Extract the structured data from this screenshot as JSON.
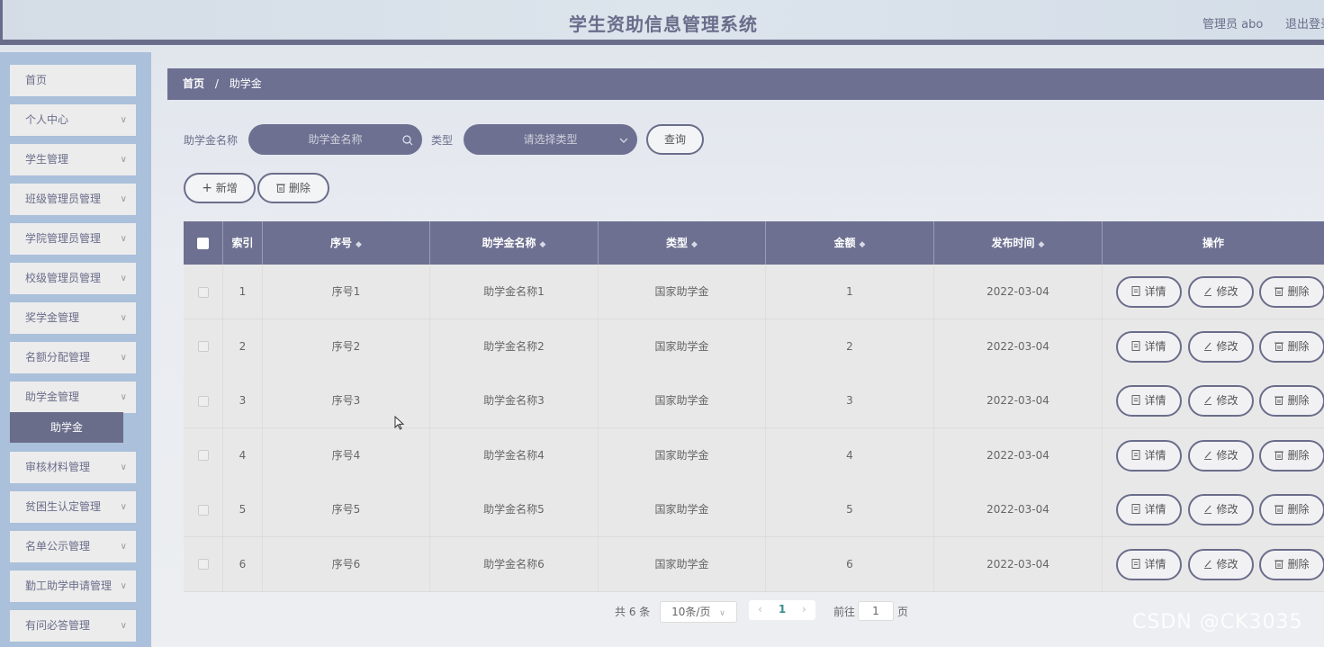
{
  "header": {
    "title": "学生资助信息管理系统",
    "user": "管理员 abo",
    "logout": "退出登录"
  },
  "sidebar": {
    "items": [
      {
        "label": "首页",
        "has_chevron": false
      },
      {
        "label": "个人中心",
        "has_chevron": true
      },
      {
        "label": "学生管理",
        "has_chevron": true
      },
      {
        "label": "班级管理员管理",
        "has_chevron": true
      },
      {
        "label": "学院管理员管理",
        "has_chevron": true
      },
      {
        "label": "校级管理员管理",
        "has_chevron": true
      },
      {
        "label": "奖学金管理",
        "has_chevron": true
      },
      {
        "label": "名额分配管理",
        "has_chevron": true
      },
      {
        "label": "助学金管理",
        "has_chevron": true
      },
      {
        "label": "审核材料管理",
        "has_chevron": true
      },
      {
        "label": "贫困生认定管理",
        "has_chevron": true
      },
      {
        "label": "名单公示管理",
        "has_chevron": true
      },
      {
        "label": "勤工助学申请管理",
        "has_chevron": true
      },
      {
        "label": "有问必答管理",
        "has_chevron": true
      }
    ],
    "active_sub": "助学金"
  },
  "breadcrumb": {
    "home": "首页",
    "sep": "/",
    "current": "助学金"
  },
  "search": {
    "name_label": "助学金名称",
    "name_placeholder": "助学金名称",
    "type_label": "类型",
    "type_placeholder": "请选择类型",
    "query_button": "查询"
  },
  "toolbar": {
    "add_label": "新增",
    "delete_label": "删除"
  },
  "table": {
    "headers": {
      "index": "索引",
      "seq": "序号",
      "name": "助学金名称",
      "type": "类型",
      "amount": "金额",
      "date": "发布时间",
      "actions": "操作"
    },
    "rows": [
      {
        "index": "1",
        "seq": "序号1",
        "name": "助学金名称1",
        "type": "国家助学金",
        "amount": "1",
        "date": "2022-03-04"
      },
      {
        "index": "2",
        "seq": "序号2",
        "name": "助学金名称2",
        "type": "国家助学金",
        "amount": "2",
        "date": "2022-03-04"
      },
      {
        "index": "3",
        "seq": "序号3",
        "name": "助学金名称3",
        "type": "国家助学金",
        "amount": "3",
        "date": "2022-03-04"
      },
      {
        "index": "4",
        "seq": "序号4",
        "name": "助学金名称4",
        "type": "国家助学金",
        "amount": "4",
        "date": "2022-03-04"
      },
      {
        "index": "5",
        "seq": "序号5",
        "name": "助学金名称5",
        "type": "国家助学金",
        "amount": "5",
        "date": "2022-03-04"
      },
      {
        "index": "6",
        "seq": "序号6",
        "name": "助学金名称6",
        "type": "国家助学金",
        "amount": "6",
        "date": "2022-03-04"
      }
    ],
    "action_labels": {
      "detail": "详情",
      "edit": "修改",
      "delete": "删除"
    }
  },
  "pagination": {
    "total": "共 6 条",
    "page_size": "10条/页",
    "current_page": "1",
    "goto_label": "前往",
    "goto_value": "1",
    "goto_suffix": "页"
  },
  "watermark": "CSDN @CK3035",
  "colors": {
    "accent": "#6d7091",
    "sidebar_bg": "#aac0db"
  }
}
